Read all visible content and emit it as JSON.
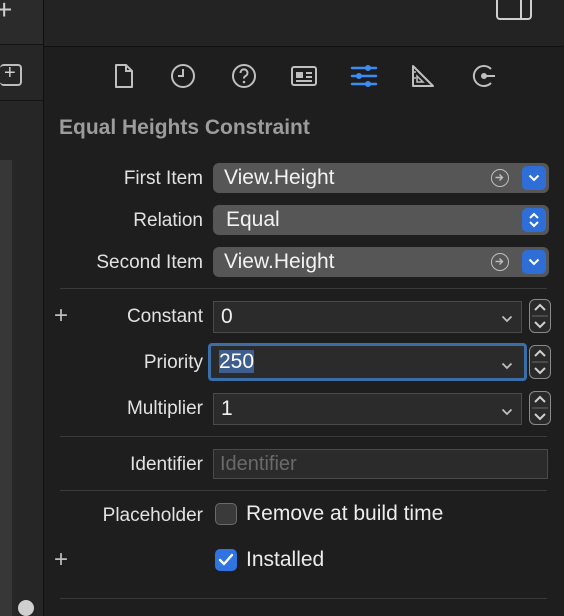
{
  "left_panel": {
    "add_label": "+"
  },
  "inspector_tabs": [
    {
      "name": "file-inspector-tab",
      "icon": "document-icon",
      "selected": false
    },
    {
      "name": "history-inspector-tab",
      "icon": "clock-icon",
      "selected": false
    },
    {
      "name": "quick-help-tab",
      "icon": "help-icon",
      "selected": false
    },
    {
      "name": "identity-inspector-tab",
      "icon": "identity-card-icon",
      "selected": false
    },
    {
      "name": "attributes-inspector-tab",
      "icon": "sliders-icon",
      "selected": true
    },
    {
      "name": "size-inspector-tab",
      "icon": "ruler-icon",
      "selected": false
    },
    {
      "name": "connections-inspector-tab",
      "icon": "connection-arrow-icon",
      "selected": false
    }
  ],
  "constraint": {
    "title": "Equal Heights Constraint",
    "first_item": {
      "label": "First Item",
      "value": "View.Height"
    },
    "relation": {
      "label": "Relation",
      "value": "Equal"
    },
    "second_item": {
      "label": "Second Item",
      "value": "View.Height"
    },
    "add_variation_label": "+",
    "constant": {
      "label": "Constant",
      "value": "0"
    },
    "priority": {
      "label": "Priority",
      "value": "250"
    },
    "multiplier": {
      "label": "Multiplier",
      "value": "1"
    },
    "identifier": {
      "label": "Identifier",
      "placeholder": "Identifier"
    },
    "placeholder": {
      "label": "Placeholder",
      "checkbox_label": "Remove at build time",
      "checked": false
    },
    "installed": {
      "checkbox_label": "Installed",
      "checked": true
    }
  },
  "colors": {
    "accent": "#2f6ed6",
    "selected_tab": "#3b8cf5"
  }
}
